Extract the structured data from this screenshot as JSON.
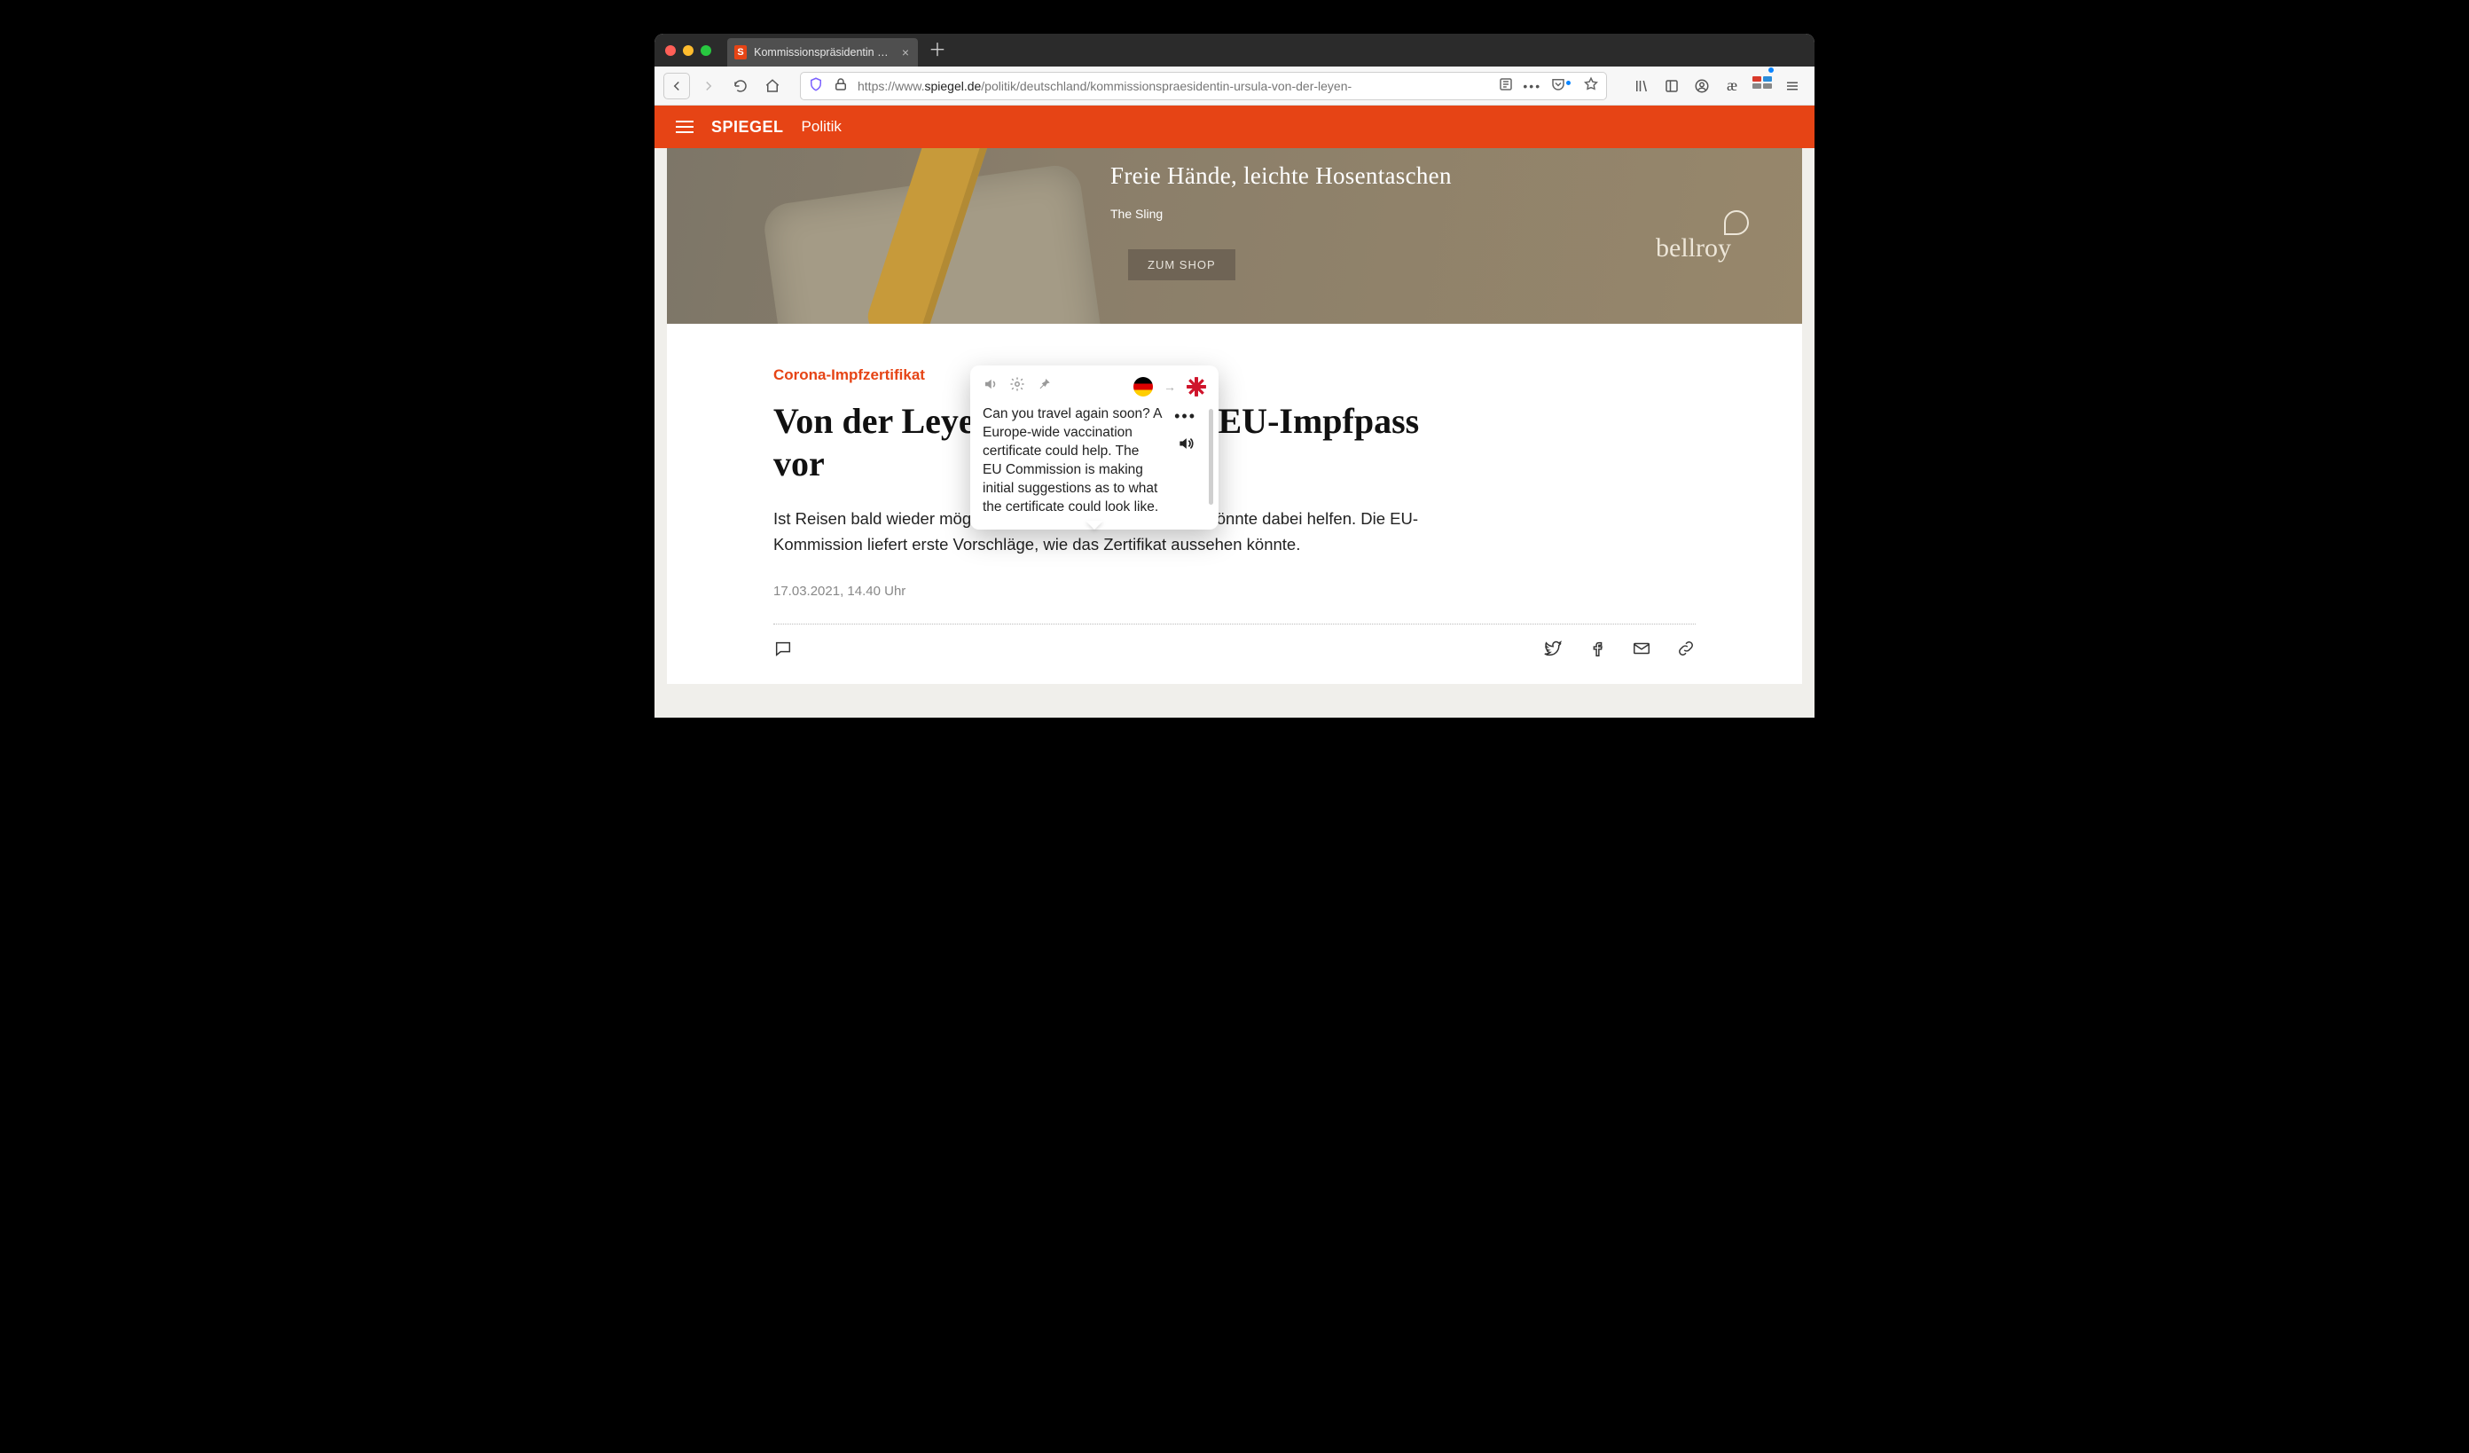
{
  "browser": {
    "tab_title": "Kommissionspräsidentin Ursula",
    "url_display_prefix": "https://www.",
    "url_display_host": "spiegel.de",
    "url_display_path": "/politik/deutschland/kommissionspraesidentin-ursula-von-der-leyen-"
  },
  "site_header": {
    "brand": "SPIEGEL",
    "section": "Politik"
  },
  "ad": {
    "headline": "Freie Hände, leichte Hosentaschen",
    "sub": "The Sling",
    "cta": "ZUM SHOP",
    "brand": "bellroy"
  },
  "article": {
    "kicker": "Corona-Impfzertifikat",
    "headline": "Von der Leyen stellt Plan für EU-Impfpass vor",
    "lede": "Ist Reisen bald wieder möglich? Ein europaweiter Impfpass könnte dabei helfen. Die EU-Kommission liefert erste Vorschläge, wie das Zertifikat aussehen könnte.",
    "timestamp": "17.03.2021, 14.40 Uhr"
  },
  "popover": {
    "source_lang": "de",
    "target_lang": "en",
    "translation": "Can you travel again soon? A Europe-wide vaccination certificate could help. The EU Commission is making initial suggestions as to what the certificate could look like."
  }
}
